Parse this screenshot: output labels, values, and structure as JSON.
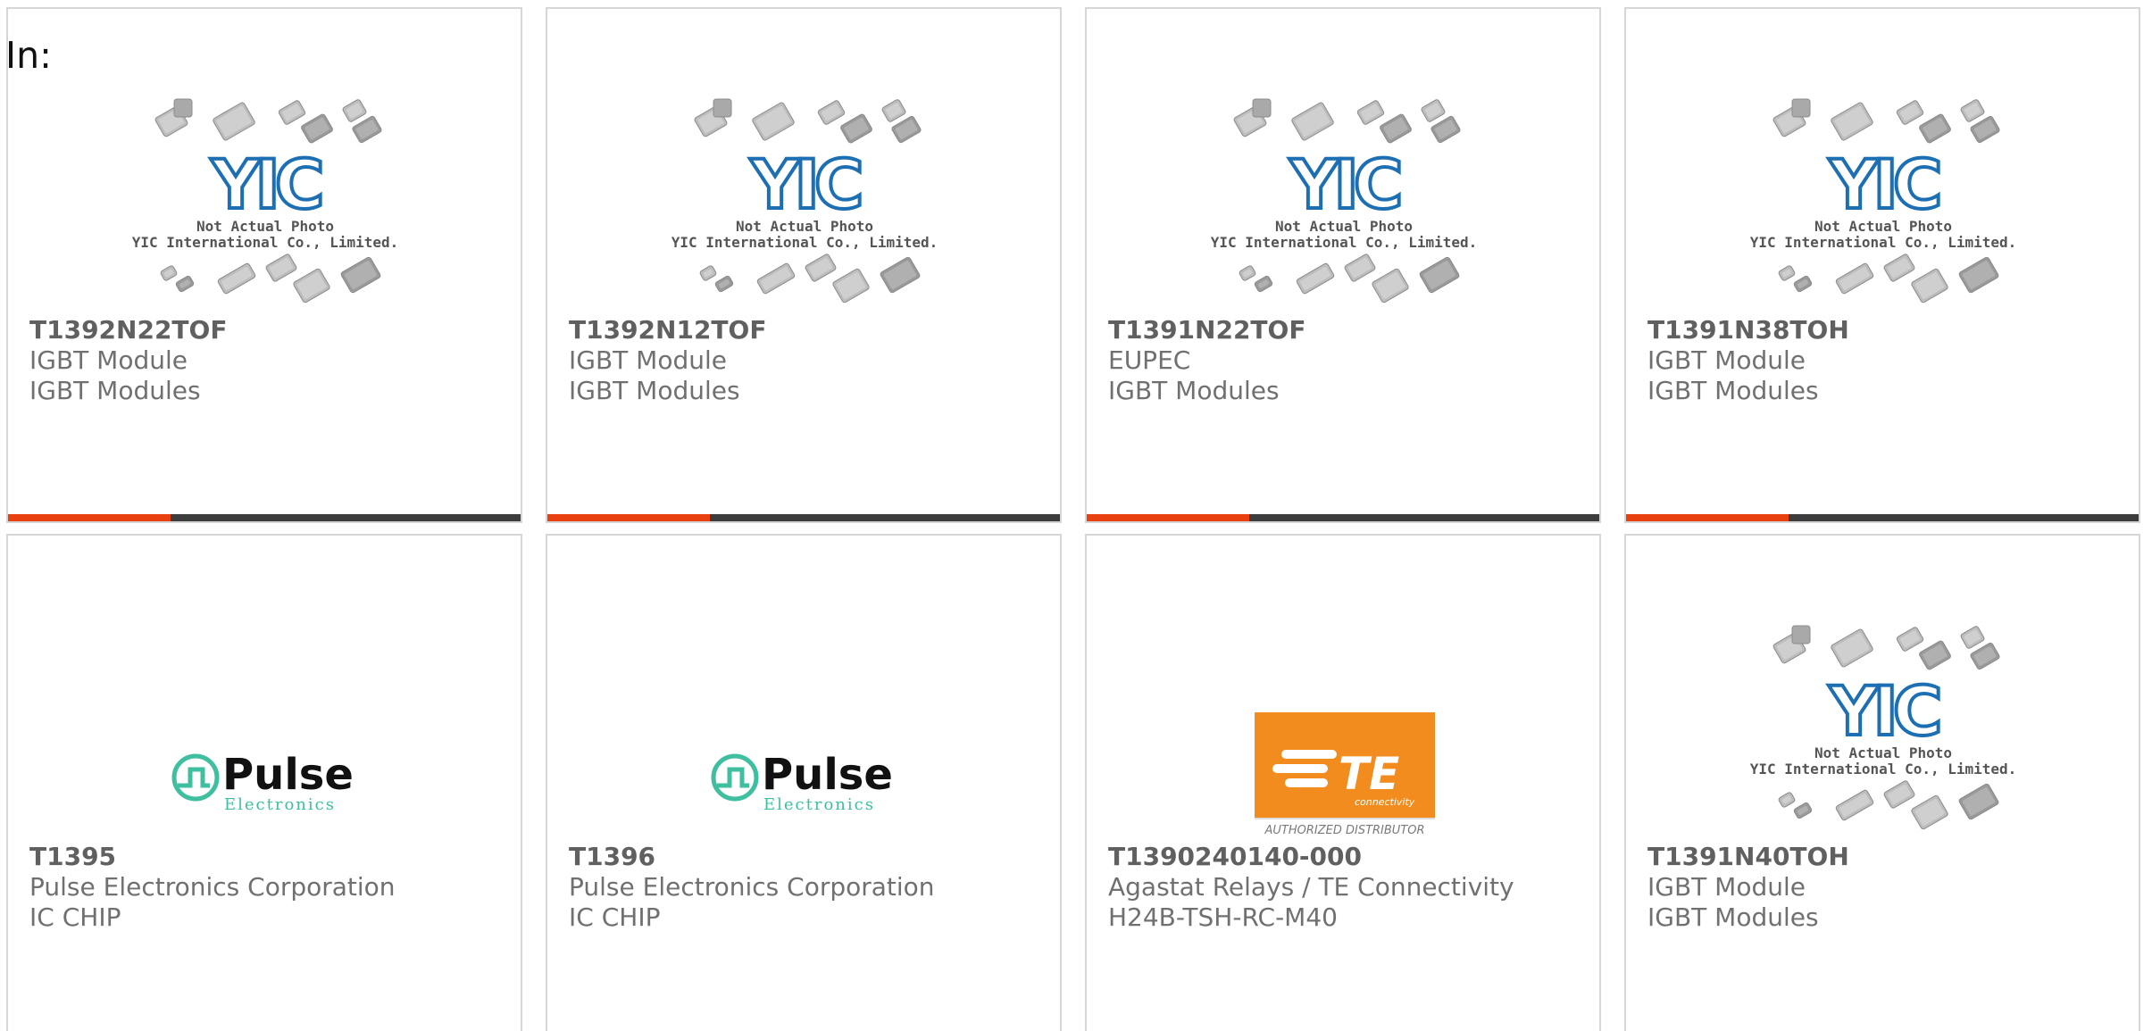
{
  "page": {
    "in_label": "In:"
  },
  "colors": {
    "accent": "#e8400f",
    "bar": "#3c3c3c",
    "border": "#d6d6d6",
    "yic_blue": "#1c6fb3",
    "pulse_teal": "#3fbf9f",
    "te_orange": "#f28c1e"
  },
  "placeholder": {
    "line1": "Not Actual Photo",
    "line2": "YIC International Co., Limited."
  },
  "logos": {
    "yic_text": "YIC",
    "pulse_name": "Pulse",
    "pulse_sub": "Electronics",
    "te_name": "TE",
    "te_sub": "connectivity",
    "te_caption": "AUTHORIZED DISTRIBUTOR"
  },
  "products": [
    {
      "part": "T1392N22TOF",
      "manufacturer": "IGBT Module",
      "category": "IGBT Modules",
      "image": "yic-placeholder",
      "bar": true
    },
    {
      "part": "T1392N12TOF",
      "manufacturer": "IGBT Module",
      "category": "IGBT Modules",
      "image": "yic-placeholder",
      "bar": true
    },
    {
      "part": "T1391N22TOF",
      "manufacturer": "EUPEC",
      "category": "IGBT Modules",
      "image": "yic-placeholder",
      "bar": true
    },
    {
      "part": "T1391N38TOH",
      "manufacturer": "IGBT Module",
      "category": "IGBT Modules",
      "image": "yic-placeholder",
      "bar": true
    },
    {
      "part": "T1395",
      "manufacturer": "Pulse Electronics Corporation",
      "category": "IC CHIP",
      "image": "pulse-logo",
      "bar": false
    },
    {
      "part": "T1396",
      "manufacturer": "Pulse Electronics Corporation",
      "category": "IC CHIP",
      "image": "pulse-logo",
      "bar": false
    },
    {
      "part": "T1390240140-000",
      "manufacturer": "Agastat Relays / TE Connectivity",
      "category": "H24B-TSH-RC-M40",
      "image": "te-logo",
      "bar": false
    },
    {
      "part": "T1391N40TOH",
      "manufacturer": "IGBT Module",
      "category": "IGBT Modules",
      "image": "yic-placeholder",
      "bar": false
    }
  ]
}
